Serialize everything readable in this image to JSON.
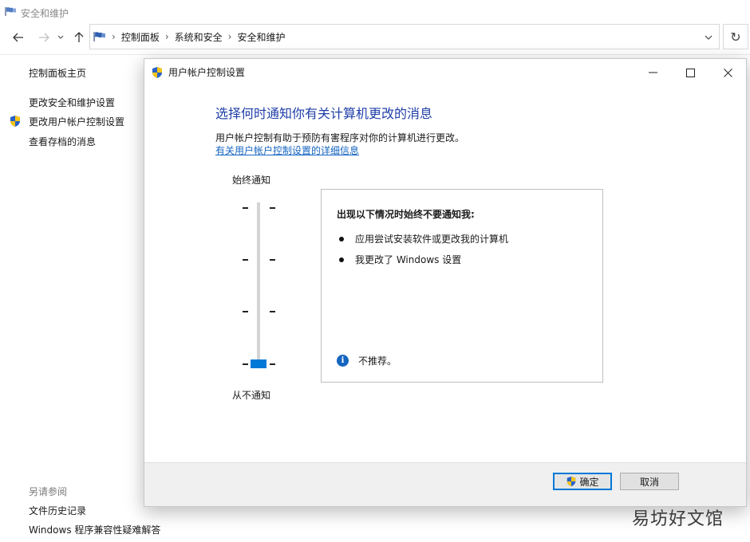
{
  "window": {
    "title": "安全和维护"
  },
  "nav": {
    "breadcrumb": [
      "控制面板",
      "系统和安全",
      "安全和维护"
    ]
  },
  "sidebar": {
    "home": "控制面板主页",
    "items": [
      "更改安全和维护设置",
      "更改用户帐户控制设置",
      "查看存档的消息"
    ],
    "see_also_title": "另请参阅",
    "see_also": [
      "文件历史记录",
      "Windows 程序兼容性疑难解答"
    ]
  },
  "dialog": {
    "title": "用户帐户控制设置",
    "heading": "选择何时通知你有关计算机更改的消息",
    "description": "用户帐户控制有助于预防有害程序对你的计算机进行更改。",
    "link": "有关用户帐户控制设置的详细信息",
    "slider": {
      "top_label": "始终通知",
      "bottom_label": "从不通知",
      "levels": 4,
      "selected_level": 1
    },
    "info": {
      "heading": "出现以下情况时始终不要通知我:",
      "bullets": [
        "应用尝试安装软件或更改我的计算机",
        "我更改了 Windows 设置"
      ],
      "note": "不推荐。"
    },
    "ok_label": "确定",
    "cancel_label": "取消"
  },
  "watermark": "易坊好文馆",
  "colors": {
    "heading": "#1f3ea8",
    "link": "#1565c0",
    "slider_thumb": "#0078d7"
  }
}
